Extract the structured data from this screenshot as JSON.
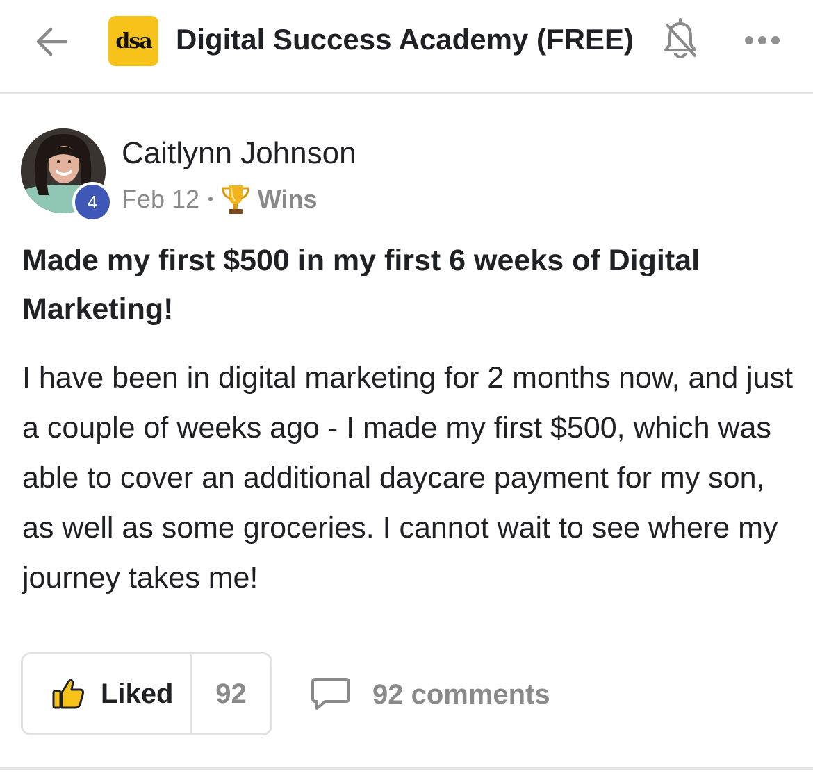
{
  "header": {
    "logo_text": "dsa",
    "group_name": "Digital Success Academy (FREE)",
    "back_icon": "arrow-left-icon",
    "bell_icon": "bell-off-icon",
    "more_icon": "more-horizontal-icon",
    "logo_color": "#f7c21a"
  },
  "post": {
    "author": "Caitlynn Johnson",
    "level": "4",
    "date": "Feb 12",
    "separator": "•",
    "category_icon": "trophy-icon",
    "category": "Wins",
    "title": "Made my first $500 in my first 6 weeks of Digital Marketing!",
    "body": "I have been in digital marketing for 2 months now, and just a couple of weeks ago - I made my first $500, which was able to cover an additional daycare payment for my son, as well as some groceries. I cannot wait to see where my journey takes me!"
  },
  "actions": {
    "like_icon": "thumbs-up-icon",
    "like_label": "Liked",
    "like_count": "92",
    "comment_icon": "comment-bubble-icon",
    "comments_label": "92 comments"
  },
  "colors": {
    "level_badge": "#3f58b8",
    "muted_text": "#8a8a8a",
    "liked_accent": "#f7c21a"
  }
}
